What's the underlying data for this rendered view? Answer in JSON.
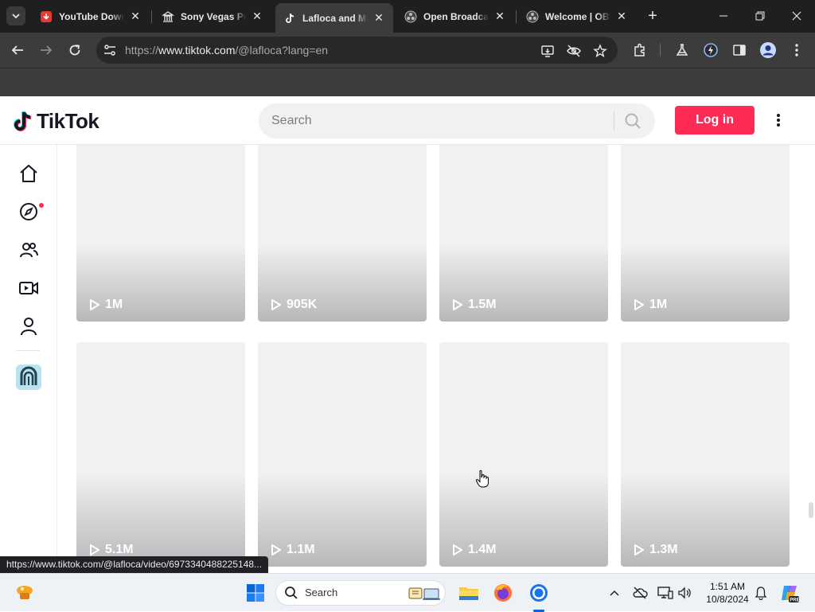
{
  "browser": {
    "tabs": [
      {
        "title": "YouTube Downl",
        "favicon": "youtube-downloader-icon",
        "active": false
      },
      {
        "title": "Sony Vegas Pro",
        "favicon": "bank-icon",
        "active": false
      },
      {
        "title": "Lafloca and Mi",
        "favicon": "tiktok-icon",
        "active": true
      },
      {
        "title": "Open Broadcas",
        "favicon": "obs-icon",
        "active": false
      },
      {
        "title": "Welcome | OBS",
        "favicon": "obs-icon",
        "active": false
      }
    ],
    "url_prefix": "https://",
    "url_host": "www.tiktok.com",
    "url_path": "/@lafloca?lang=en",
    "status_url": "https://www.tiktok.com/@lafloca/video/6973340488225148..."
  },
  "tiktok": {
    "logo_text": "TikTok",
    "search_placeholder": "Search",
    "login_label": "Log in",
    "videos": [
      {
        "views": "1M"
      },
      {
        "views": "905K"
      },
      {
        "views": "1.5M"
      },
      {
        "views": "1M"
      },
      {
        "views": "5.1M"
      },
      {
        "views": "1.1M"
      },
      {
        "views": "1.4M"
      },
      {
        "views": "1.3M"
      }
    ],
    "accent": "#fe2c55"
  },
  "taskbar": {
    "search_label": "Search",
    "time": "1:51 AM",
    "date": "10/8/2024",
    "accent": "#0a64d8"
  }
}
